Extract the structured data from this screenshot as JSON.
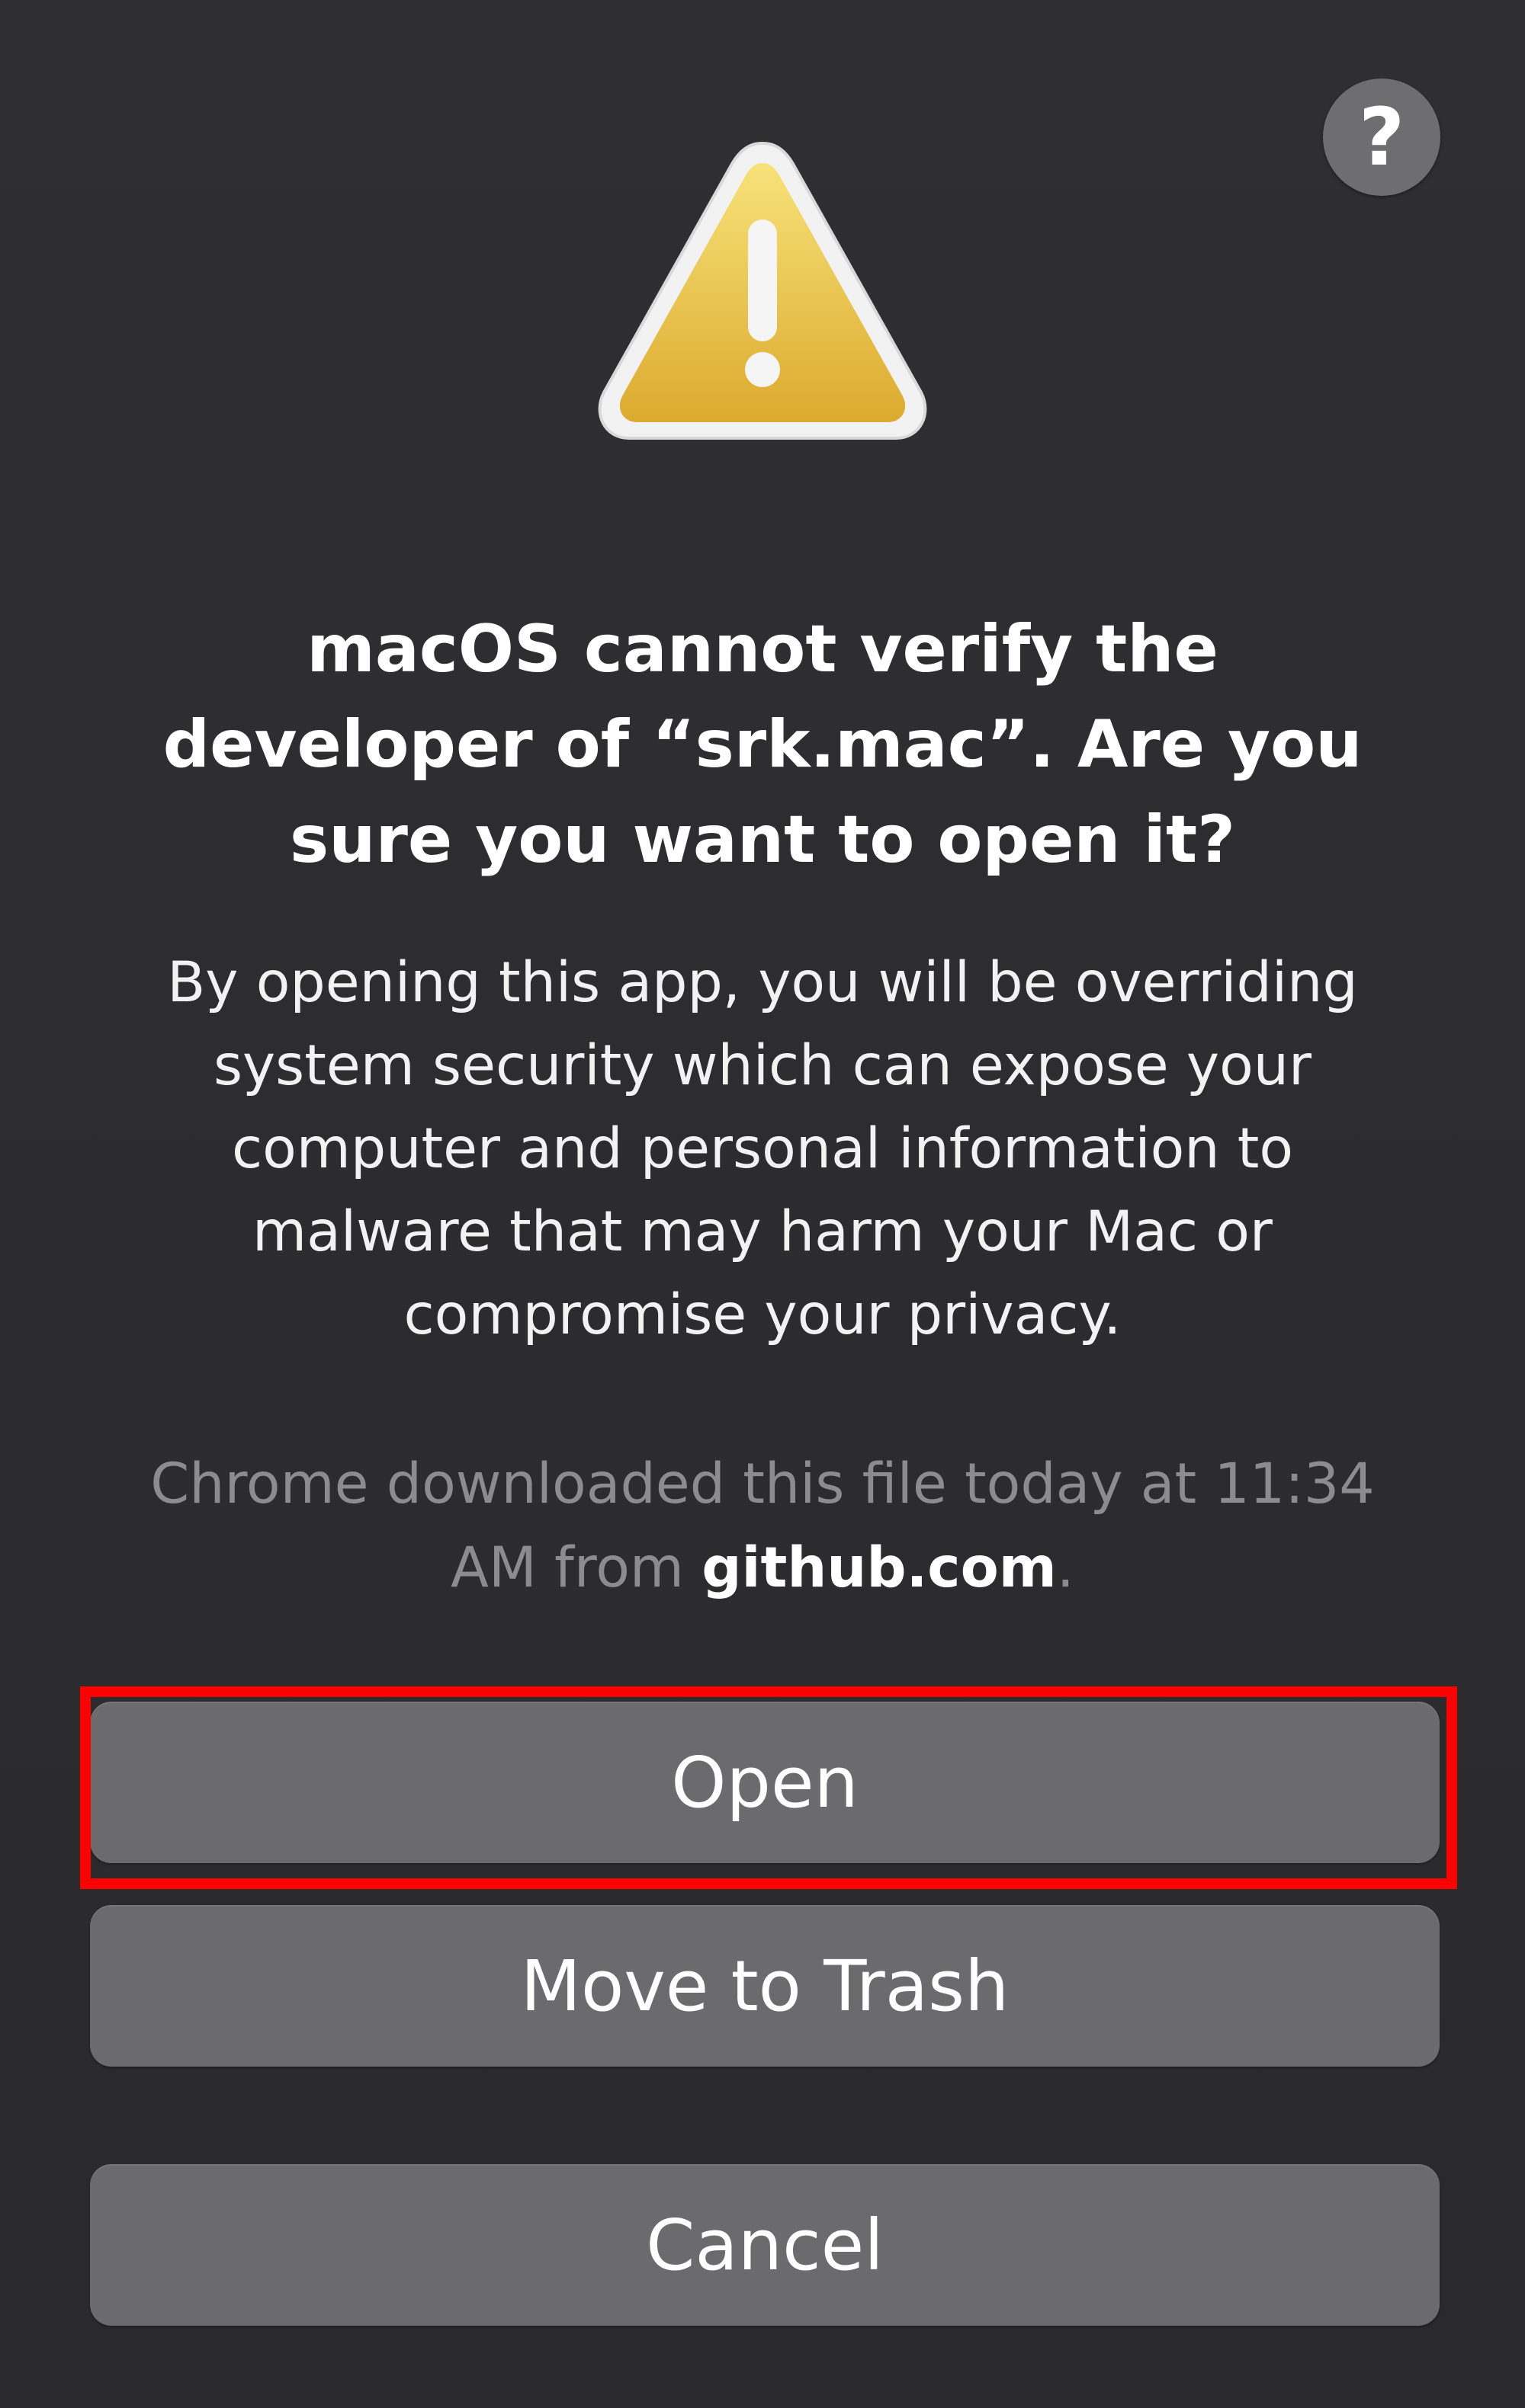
{
  "dialog": {
    "help_label": "?",
    "title": "macOS cannot verify the developer of “srk.mac”. Are you sure you want to open it?",
    "body": "By opening this app, you will be overriding system security which can expose your computer and personal information to malware that may harm your Mac or compromise your privacy.",
    "source_prefix": "Chrome downloaded this file today at 11:34 AM from ",
    "source_domain": "github.com",
    "source_suffix": ".",
    "icon": "warning-triangle-icon"
  },
  "buttons": {
    "open_label": "Open",
    "trash_label": "Move to Trash",
    "cancel_label": "Cancel"
  },
  "colors": {
    "background": "#2c2c2e",
    "button": "#6b6b6d",
    "highlight": "#ff0000",
    "warning_yellow": "#f1cc4d"
  }
}
